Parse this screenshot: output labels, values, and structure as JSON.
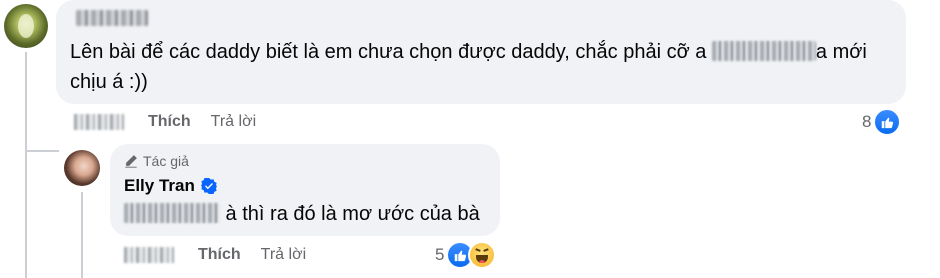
{
  "comment_1": {
    "text_before_blur": "Lên bài để các daddy biết là em chưa chọn được daddy, chắc phải cỡ a ",
    "text_after_blur": "a mới chịu á :))",
    "like_label": "Thích",
    "reply_label": "Trả lời",
    "reaction_count": "8",
    "reaction_icons": [
      "like-icon"
    ]
  },
  "comment_2": {
    "badge_label": "Tác giả",
    "badge_icon": "pen-icon",
    "author_name": "Elly Tran",
    "author_verified_icon": "verified-badge-icon",
    "text_after_blur": " à thì ra đó là mơ ước của bà",
    "like_label": "Thích",
    "reply_label": "Trả lời",
    "reaction_count": "5",
    "reaction_icons": [
      "like-icon",
      "haha-icon"
    ]
  },
  "colors": {
    "bubble_bg": "#f0f2f5",
    "meta_text": "#65676b",
    "like_blue": "#0a6cf0",
    "verified_blue": "#0866ff"
  }
}
